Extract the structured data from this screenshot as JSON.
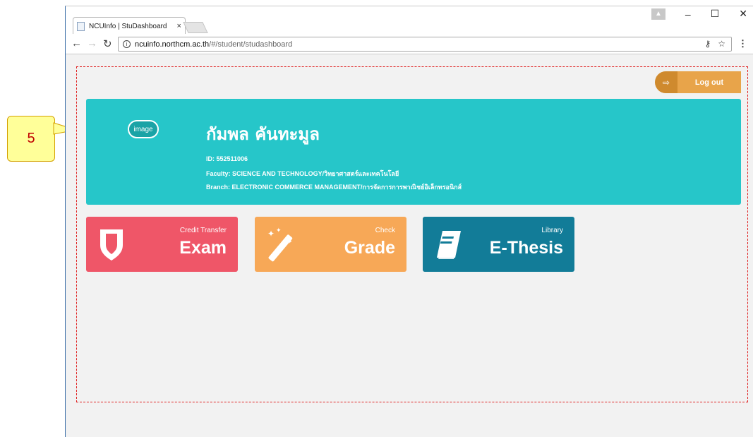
{
  "browser": {
    "tab_title": "NCUInfo | StuDashboard",
    "tab_close": "×",
    "url_host": "ncuinfo.northcm.ac.th",
    "url_path": "/#/student/studashboard",
    "window_controls": {
      "minimize": "–",
      "maximize": "☐",
      "close": "✕"
    }
  },
  "header": {
    "logout_label": "Log out"
  },
  "profile": {
    "avatar_text": "image",
    "name": "กัมพล คันทะมูล",
    "id_line": "ID: 552511006",
    "faculty_line": "Faculty: SCIENCE AND TECHNOLOGY/วิทยาศาสตร์และเทคโนโลยี",
    "branch_line": "Branch: ELECTRONIC COMMERCE MANAGEMENT/การจัดการการพาณิชย์อิเล็กทรอนิกส์"
  },
  "tiles": [
    {
      "small": "Credit Transfer",
      "big": "Exam",
      "color": "#ef5668",
      "icon": "shield-icon"
    },
    {
      "small": "Check",
      "big": "Grade",
      "color": "#f7a857",
      "icon": "magic-wand-icon"
    },
    {
      "small": "Library",
      "big": "E-Thesis",
      "color": "#127c98",
      "icon": "book-icon"
    }
  ],
  "callout": {
    "number": "5"
  }
}
